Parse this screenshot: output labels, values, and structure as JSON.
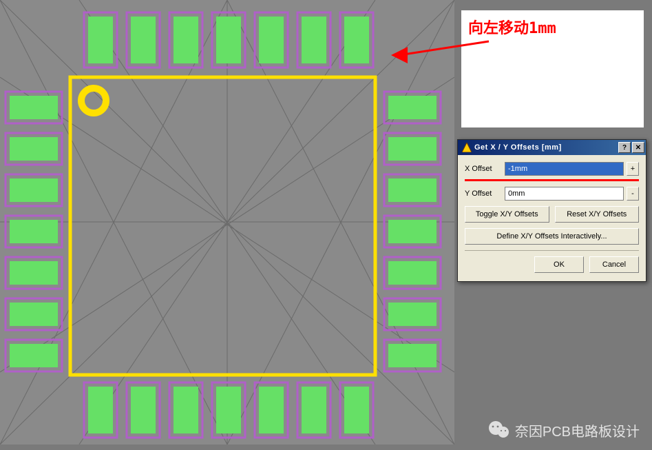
{
  "annotation": {
    "text": "向左移动1mm"
  },
  "dialog": {
    "title": "Get X / Y Offsets [mm]",
    "help_glyph": "?",
    "close_glyph": "✕",
    "x_label": "X Offset",
    "x_value": "-1mm",
    "x_step_glyph": "+",
    "y_label": "Y Offset",
    "y_value": "0mm",
    "y_step_glyph": "-",
    "toggle_btn": "Toggle X/Y Offsets",
    "reset_btn": "Reset X/Y Offsets",
    "define_btn": "Define X/Y Offsets Interactively...",
    "ok_btn": "OK",
    "cancel_btn": "Cancel"
  },
  "watermark": {
    "text": "奈因PCB电路板设计"
  },
  "colors": {
    "pad_fill": "#66e066",
    "pad_stroke": "#b060c8",
    "body_stroke": "#ffe000",
    "pin1_ring": "#ffe000",
    "guide": "#6a6a6a"
  }
}
